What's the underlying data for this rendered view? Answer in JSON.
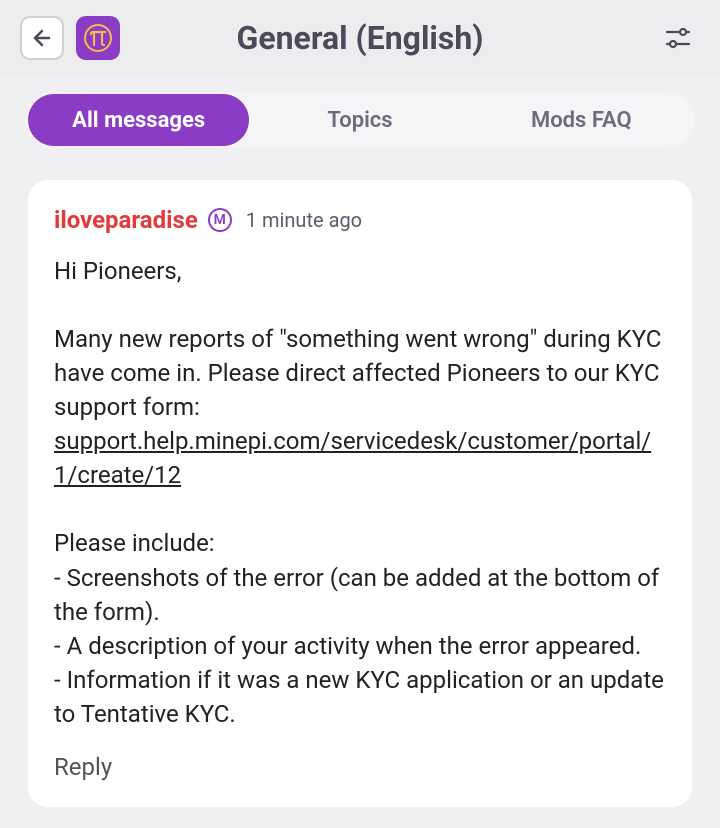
{
  "header": {
    "title": "General (English)"
  },
  "tabs": [
    {
      "label": "All messages",
      "active": true
    },
    {
      "label": "Topics",
      "active": false
    },
    {
      "label": "Mods FAQ",
      "active": false
    }
  ],
  "message": {
    "username": "iloveparadise",
    "mod_badge_letter": "M",
    "timestamp": "1 minute ago",
    "greeting": "Hi Pioneers,",
    "para1": "Many new reports of \"something went wrong\" during KYC have come in. Please direct affected Pioneers to our KYC support form:",
    "link_text": "support.help.minepi.com/servicedesk/customer/portal/1/create/12",
    "para2": "Please include:",
    "bullet1": "- Screenshots of the error (can be added at the bottom of the form).",
    "bullet2": "- A description of your activity when the error appeared.",
    "bullet3": "- Information if it was a new KYC application or an update to Tentative KYC.",
    "reply_label": "Reply"
  }
}
